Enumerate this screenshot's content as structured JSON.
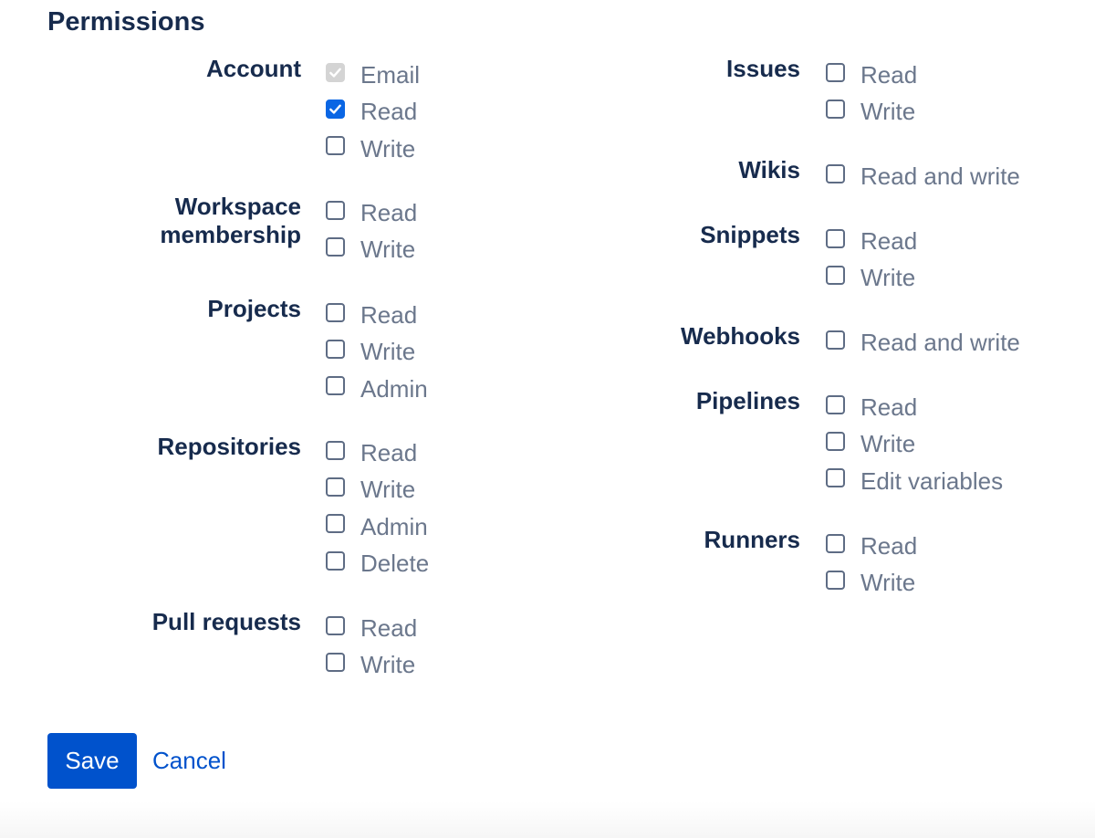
{
  "title": "Permissions",
  "accent_color": "#0052cc",
  "left_groups": [
    {
      "label": "Account",
      "options": [
        {
          "label": "Email",
          "state": "disabled-checked"
        },
        {
          "label": "Read",
          "state": "checked"
        },
        {
          "label": "Write",
          "state": "unchecked"
        }
      ]
    },
    {
      "label": "Workspace\nmembership",
      "options": [
        {
          "label": "Read",
          "state": "unchecked"
        },
        {
          "label": "Write",
          "state": "unchecked"
        }
      ]
    },
    {
      "label": "Projects",
      "options": [
        {
          "label": "Read",
          "state": "unchecked"
        },
        {
          "label": "Write",
          "state": "unchecked"
        },
        {
          "label": "Admin",
          "state": "unchecked"
        }
      ]
    },
    {
      "label": "Repositories",
      "options": [
        {
          "label": "Read",
          "state": "unchecked"
        },
        {
          "label": "Write",
          "state": "unchecked"
        },
        {
          "label": "Admin",
          "state": "unchecked"
        },
        {
          "label": "Delete",
          "state": "unchecked"
        }
      ]
    },
    {
      "label": "Pull requests",
      "options": [
        {
          "label": "Read",
          "state": "unchecked"
        },
        {
          "label": "Write",
          "state": "unchecked"
        }
      ]
    }
  ],
  "right_groups": [
    {
      "label": "Issues",
      "options": [
        {
          "label": "Read",
          "state": "unchecked"
        },
        {
          "label": "Write",
          "state": "unchecked"
        }
      ]
    },
    {
      "label": "Wikis",
      "options": [
        {
          "label": "Read and write",
          "state": "unchecked"
        }
      ]
    },
    {
      "label": "Snippets",
      "options": [
        {
          "label": "Read",
          "state": "unchecked"
        },
        {
          "label": "Write",
          "state": "unchecked"
        }
      ]
    },
    {
      "label": "Webhooks",
      "options": [
        {
          "label": "Read and write",
          "state": "unchecked"
        }
      ]
    },
    {
      "label": "Pipelines",
      "options": [
        {
          "label": "Read",
          "state": "unchecked"
        },
        {
          "label": "Write",
          "state": "unchecked"
        },
        {
          "label": "Edit variables",
          "state": "unchecked"
        }
      ]
    },
    {
      "label": "Runners",
      "options": [
        {
          "label": "Read",
          "state": "unchecked"
        },
        {
          "label": "Write",
          "state": "unchecked"
        }
      ]
    }
  ],
  "actions": {
    "save_label": "Save",
    "cancel_label": "Cancel"
  }
}
